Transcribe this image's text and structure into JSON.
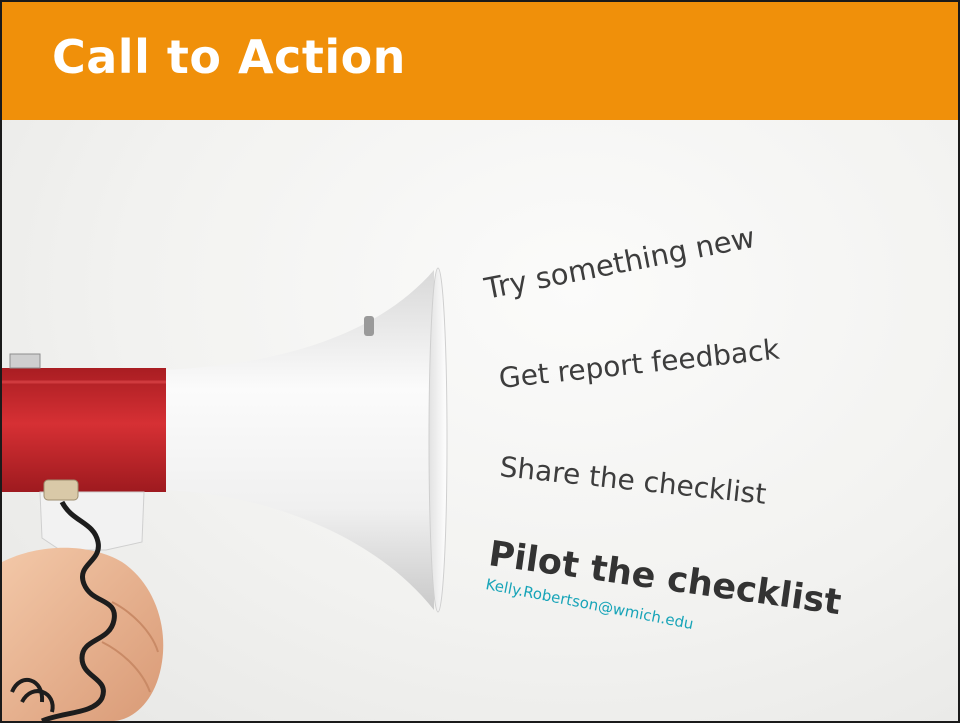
{
  "slide": {
    "title": "Call to Action",
    "items": [
      "Try something new",
      "Get report feedback",
      "Share the checklist",
      "Pilot the checklist"
    ],
    "email": "Kelly.Robertson@wmich.edu"
  },
  "colors": {
    "title_bar": "#f0900a",
    "title_text": "#ffffff",
    "body_text": "#3d3d3d",
    "email_text": "#17a4b8",
    "megaphone_red": "#c8262a",
    "megaphone_white": "#f4f4f4"
  },
  "image": {
    "subject": "megaphone-in-hand"
  }
}
